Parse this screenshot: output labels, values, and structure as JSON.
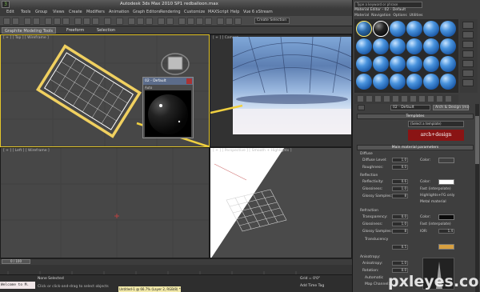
{
  "window": {
    "title": "Autodesk 3ds Max  2010 SP1    redballoon.max"
  },
  "menubar": [
    "Edit",
    "Tools",
    "Group",
    "Views",
    "Create",
    "Modifiers",
    "Animation",
    "Graph Editors",
    "Rendering",
    "Customize",
    "MAXScript",
    "Help",
    "Vue 6 xStream"
  ],
  "toolbar": {
    "selection_dropdown": "Create Selection"
  },
  "ribbon": {
    "tabs": [
      "Graphite Modeling Tools",
      "Freeform",
      "Selection"
    ]
  },
  "viewports": {
    "top_label": "[ + ] [ Top ] [ Wireframe ]",
    "camera_label": "[ + ] [ Camera",
    "left_label": "[ + ] [ Left ] [ Wireframe ]",
    "persp_label": "[ + ] [ Perspective ] [ Smooth + Highlights ]"
  },
  "material_popup": {
    "title": "02 - Default",
    "subtitle": "Auto"
  },
  "timeline": {
    "slider": "0 / 100"
  },
  "status": {
    "maxscript": "Welcome to M.",
    "selection": "None Selected",
    "prompt": "Click or click-and-drag to select objects",
    "render_msg": "Untitled-1 @ 66.7% (Layer 2, RGB/8) *",
    "grid": "Grid = 0'0\"",
    "time_tag": "Add Time Tag"
  },
  "material_editor": {
    "search_placeholder": "Type a keyword or phrase",
    "title": "Material Editor - 02 - Default",
    "menu": [
      "Material",
      "Navigation",
      "Options",
      "Utilities"
    ],
    "material_name": "02 - Default",
    "material_type": "Arch & Design (mi)",
    "templates_header": "Templates",
    "templates_select": "(Select a template)",
    "arch_logo": "arch+design",
    "main_params_header": "Main material parameters",
    "diffuse_section": "Diffuse",
    "diffuse_level_label": "Diffuse Level:",
    "diffuse_level": "1.0",
    "roughness_label": "Roughness:",
    "roughness": "0.0",
    "color_label": "Color:",
    "reflection_section": "Reflection",
    "reflectivity_label": "Reflectivity:",
    "reflectivity": "0.6",
    "glossiness_label": "Glossiness:",
    "glossiness": "1.0",
    "glossy_samples_label": "Glossy Samples:",
    "glossy_samples": "8",
    "fast_interp": "Fast (interpolate)",
    "highlights_fg": "Highlights+FG only",
    "metal_material": "Metal material",
    "refraction_section": "Refraction",
    "transparency_label": "Transparency:",
    "transparency": "0.0",
    "r_glossiness": "1.0",
    "r_glossy_samples": "8",
    "ior_label": "IOR:",
    "ior": "1.4",
    "translucency": "Translucency",
    "weight": "0.5",
    "anisotropy_label": "Anisotropy:",
    "anisotropy": "1.0",
    "rotation_label": "Rotation:",
    "rotation": "0.0",
    "automatic": "Automatic",
    "map_channel": "Map Channel:"
  },
  "watermark": "pxleyes.com"
}
